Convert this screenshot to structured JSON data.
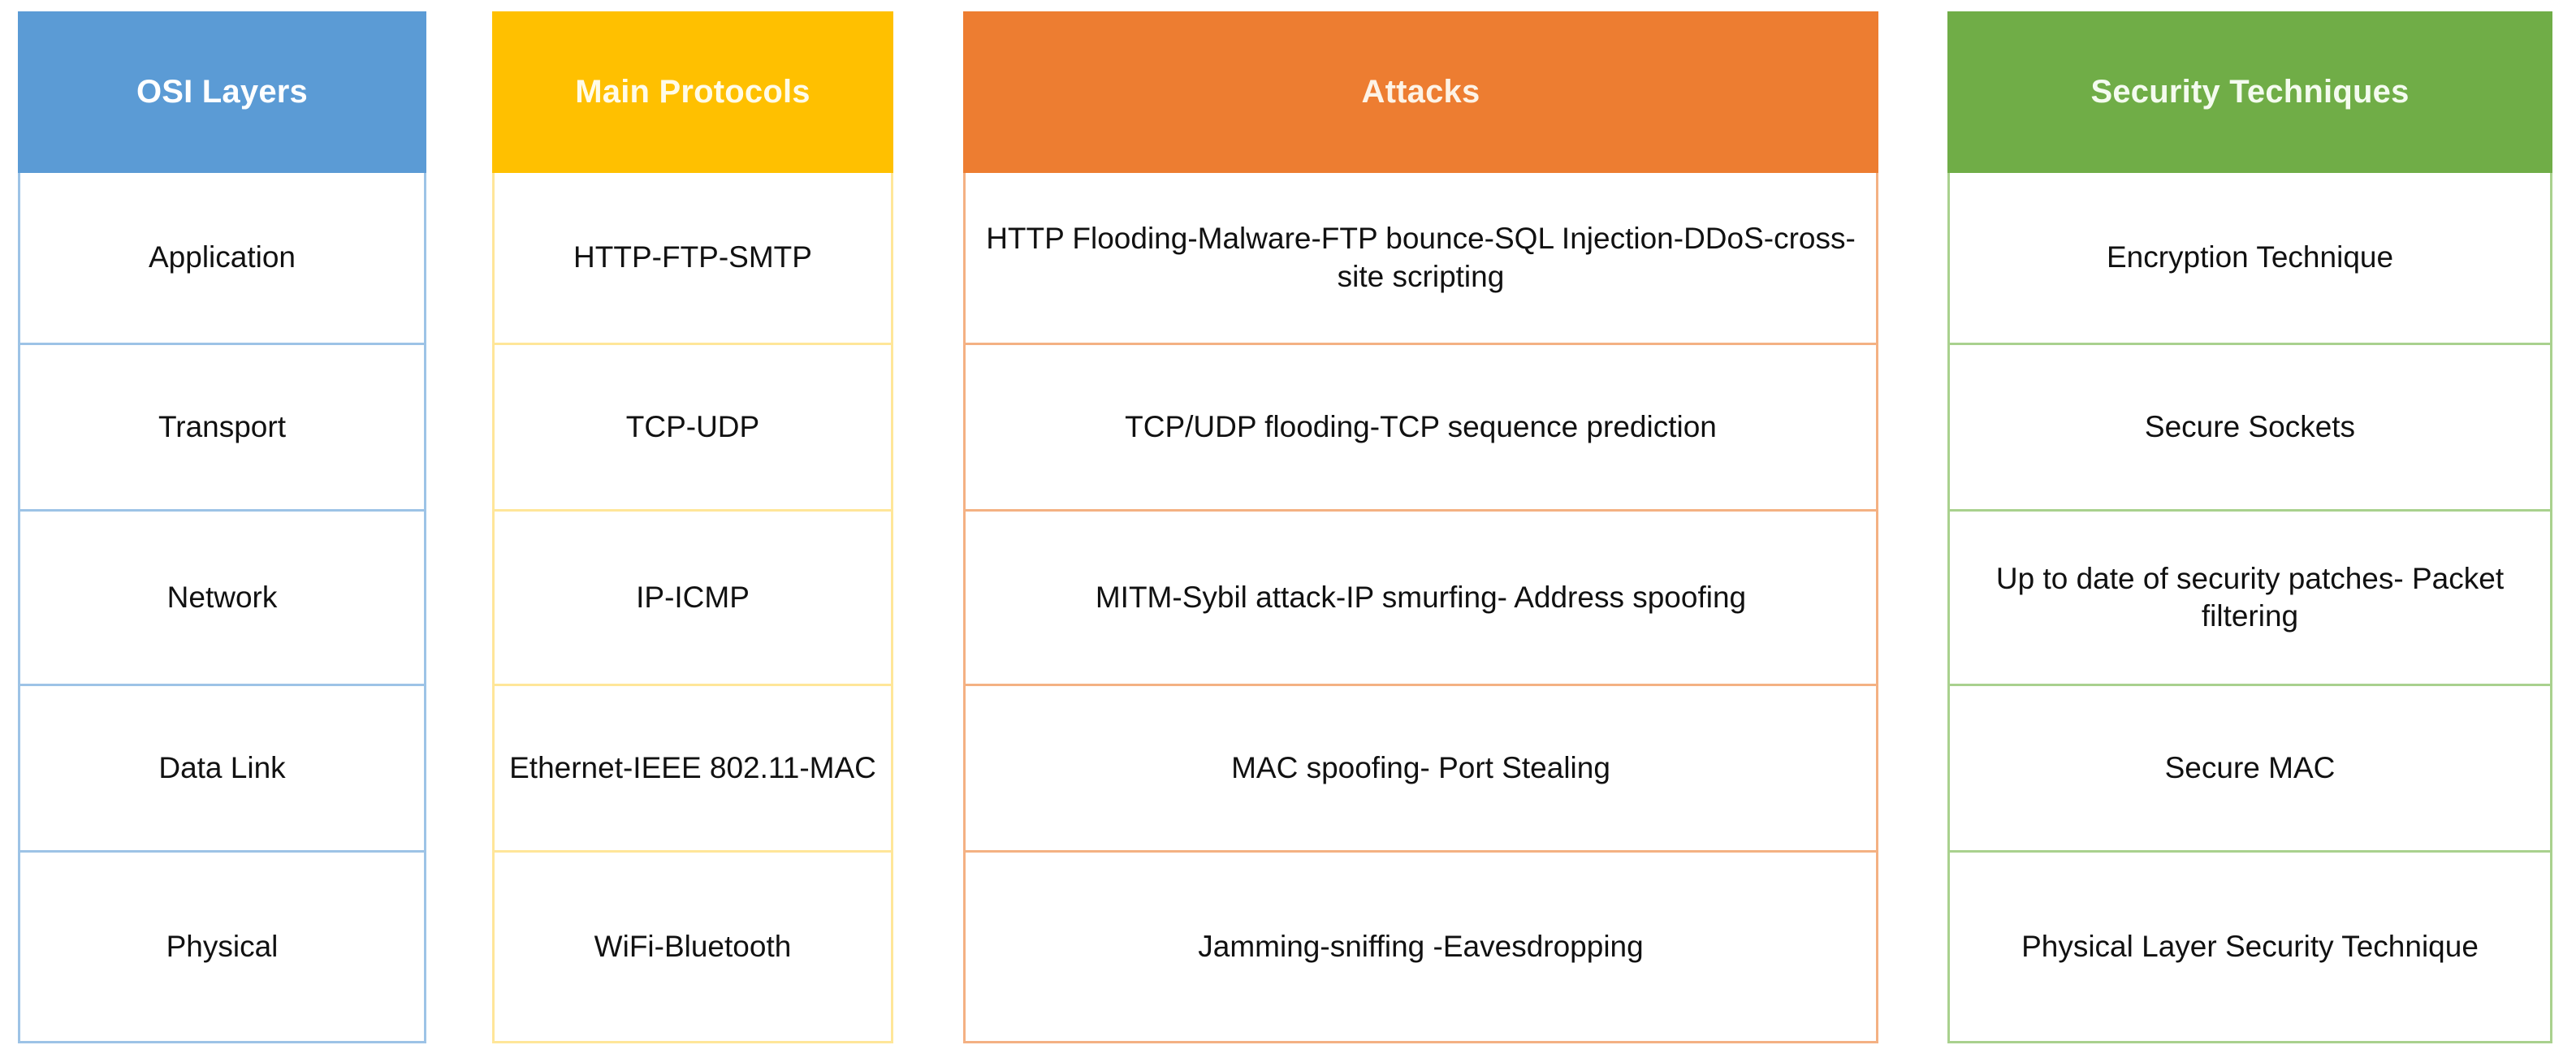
{
  "table": {
    "columns": [
      {
        "key": "osi_layers",
        "header": "OSI Layers",
        "header_bg": "#5B9BD5",
        "header_color": "#FFFFFF",
        "border_color": "#9DC3E6",
        "cells": [
          "Application",
          "Transport",
          "Network",
          "Data Link",
          "Physical"
        ]
      },
      {
        "key": "main_protocols",
        "header": "Main Protocols",
        "header_bg": "#FFC000",
        "header_color": "#FFFBE8",
        "border_color": "#FFE699",
        "cells": [
          "HTTP-FTP-SMTP",
          "TCP-UDP",
          "IP-ICMP",
          "Ethernet-IEEE 802.11-MAC",
          "WiFi-Bluetooth"
        ]
      },
      {
        "key": "attacks",
        "header": "Attacks",
        "header_bg": "#ED7D31",
        "header_color": "#FDF3E6",
        "border_color": "#F4B183",
        "cells": [
          "HTTP Flooding-Malware-FTP bounce-SQL Injection-DDoS-cross-site scripting",
          "TCP/UDP flooding-TCP sequence prediction",
          "MITM-Sybil attack-IP smurfing- Address spoofing",
          "MAC spoofing- Port Stealing",
          "Jamming-sniffing -Eavesdropping"
        ]
      },
      {
        "key": "security_techniques",
        "header": "Security Techniques",
        "header_bg": "#70AD47",
        "header_color": "#F4FBEF",
        "border_color": "#A9D18E",
        "cells": [
          "Encryption Technique",
          "Secure Sockets",
          "Up to date of security patches- Packet filtering",
          "Secure MAC",
          "Physical Layer Security Technique"
        ]
      }
    ]
  }
}
